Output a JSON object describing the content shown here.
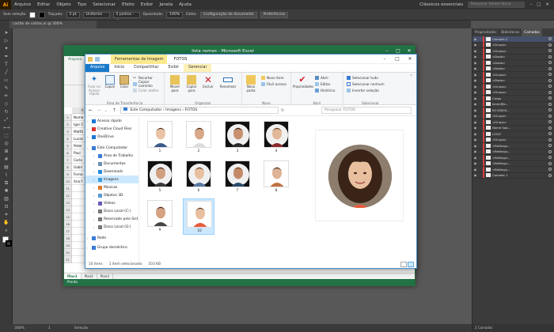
{
  "illustrator": {
    "menu": [
      "Arquivo",
      "Editar",
      "Objeto",
      "Tipo",
      "Selecionar",
      "Efeito",
      "Exibir",
      "Janela",
      "Ajuda"
    ],
    "logo": "Ai",
    "workspace": "Clássicos essenciais",
    "search_placeholder": "Pesquisar Adobe Stock",
    "control": {
      "selection_label": "Sem seleção",
      "stroke_label": "Traçado:",
      "stroke_value": "2 pt",
      "stroke_style": "Uniforme",
      "brush": "5 pontos - ...",
      "opacity_label": "Opacidade:",
      "opacity_value": "100%",
      "style_label": "Estilo:",
      "doc_setup": "Configuração de documento",
      "prefs": "Preferências"
    },
    "doc_tab": "cartão de visitas.ai @ 300% (CMYK/Visualização)",
    "status": {
      "zoom": "300%",
      "page": "1",
      "tool": "Seleção"
    },
    "panel": {
      "tabs": [
        "Propriedades",
        "Bibliotecas",
        "Camadas"
      ],
      "active_tab": "Camadas",
      "layers": [
        {
          "name": "Camada 2",
          "selected": true
        },
        {
          "name": "<Grupo>"
        },
        {
          "name": "<Grupo>"
        },
        {
          "name": "<Dado>"
        },
        {
          "name": "<Dado>"
        },
        {
          "name": "<Dado>"
        },
        {
          "name": "<Grupo>"
        },
        {
          "name": "<Dado>"
        },
        {
          "name": "<Grupo>"
        },
        {
          "name": "<Grupo>"
        },
        {
          "name": "Cargo"
        },
        {
          "name": "Ionim@e..."
        },
        {
          "name": "00 00000..."
        },
        {
          "name": "<Grupo>"
        },
        {
          "name": "<Grupo>"
        },
        {
          "name": "Nome Sob..."
        },
        {
          "name": "LOGO"
        },
        {
          "name": "<Grupo>"
        },
        {
          "name": "<Retângu..."
        },
        {
          "name": "<Retângu..."
        },
        {
          "name": "<Retângu..."
        },
        {
          "name": "<Retângu..."
        },
        {
          "name": "<Retângu..."
        },
        {
          "name": "Camada 1"
        }
      ],
      "footer": "2 Camadas"
    }
  },
  "excel": {
    "title": "lista nomes - Microsoft Excel",
    "tabs": [
      "Arquivo",
      "Página Inicial",
      "Inserir",
      "Layout da Página",
      "Fórmulas",
      "Dados",
      "Revisão",
      "Exibição"
    ],
    "columns": [
      "A",
      "B",
      "C",
      "D",
      "E",
      "F",
      "G",
      "H",
      "I",
      "J",
      "K",
      "L",
      "M",
      "N",
      "O",
      "P"
    ],
    "rows": [
      "1",
      "2",
      "3",
      "4",
      "5",
      "6",
      "7",
      "8",
      "9",
      "10",
      "11",
      "12",
      "13",
      "14",
      "15",
      "16",
      "17",
      "18",
      "19",
      "20",
      "21",
      "22",
      "23"
    ],
    "cells": [
      "Nome",
      "Igor C",
      "Matth",
      "Lucas",
      "Peter",
      "Paul",
      "Carlo",
      "Gabri",
      "Ferna",
      "Ana F"
    ],
    "sheets": [
      "Plan1",
      "Plan2",
      "Plan3"
    ],
    "status": "Pronto"
  },
  "explorer": {
    "title": "FOTOS",
    "context_tab": "Ferramentas de Imagem",
    "tabs": [
      "Arquivo",
      "Início",
      "Compartilhar",
      "Exibir",
      "Gerenciar"
    ],
    "ribbon": {
      "clipboard": {
        "label": "Área de Transferência",
        "pin": "Fixar no Acesso rápido",
        "copy": "Copiar",
        "paste": "Colar",
        "cut": "Recortar",
        "copy_path": "Copiar caminho",
        "paste_shortcut": "Colar atalho"
      },
      "organize": {
        "label": "Organizar",
        "move": "Mover para",
        "copy": "Copiar para",
        "delete": "Excluir",
        "rename": "Renomear"
      },
      "new": {
        "label": "Novo",
        "folder": "Nova pasta",
        "item": "Novo item",
        "easy": "Fácil acesso"
      },
      "open": {
        "label": "Abrir",
        "props": "Propriedades",
        "open": "Abrir",
        "edit": "Editar",
        "history": "Histórico"
      },
      "select": {
        "label": "Selecionar",
        "all": "Selecionar tudo",
        "none": "Selecionar nenhum",
        "invert": "Inverter seleção"
      }
    },
    "path": [
      "Este Computador",
      "Imagens",
      "FOTOS"
    ],
    "search_placeholder": "Pesquisar FOTOS",
    "nav": [
      {
        "label": "Acesso rápido",
        "color": "#1e78d6"
      },
      {
        "label": "Creative Cloud Files",
        "color": "#d33"
      },
      {
        "label": "OneDrive",
        "color": "#1e78d6"
      },
      {
        "label": "Este Computador",
        "color": "#3a7bd5"
      },
      {
        "label": "Área de Trabalho",
        "color": "#3a7bd5"
      },
      {
        "label": "Documentos",
        "color": "#6b8fb5"
      },
      {
        "label": "Downloads",
        "color": "#2a8bd8"
      },
      {
        "label": "Imagens",
        "color": "#3a9ad8"
      },
      {
        "label": "Músicas",
        "color": "#d87a2a"
      },
      {
        "label": "Objetos 3D",
        "color": "#5a9ad8"
      },
      {
        "label": "Vídeos",
        "color": "#6b5ab5"
      },
      {
        "label": "Disco Local (C:)",
        "color": "#777"
      },
      {
        "label": "Reservado pelo Sist",
        "color": "#777"
      },
      {
        "label": "Disco Local (G:)",
        "color": "#777"
      },
      {
        "label": "Rede",
        "color": "#3a7bd5"
      },
      {
        "label": "Grupo doméstico",
        "color": "#3a7bd5"
      }
    ],
    "files": [
      {
        "name": "1",
        "style": "plain"
      },
      {
        "name": "2",
        "style": "plain"
      },
      {
        "name": "3",
        "style": "dark"
      },
      {
        "name": "4",
        "style": "dark"
      },
      {
        "name": "5",
        "style": "dark"
      },
      {
        "name": "6",
        "style": "dark"
      },
      {
        "name": "7",
        "style": "dark"
      },
      {
        "name": "8",
        "style": "plain"
      },
      {
        "name": "9",
        "style": "plain"
      },
      {
        "name": "10",
        "style": "plain",
        "selected": true
      }
    ],
    "status": {
      "count": "10 itens",
      "selection": "1 item selecionado",
      "size": "103 KB"
    }
  }
}
